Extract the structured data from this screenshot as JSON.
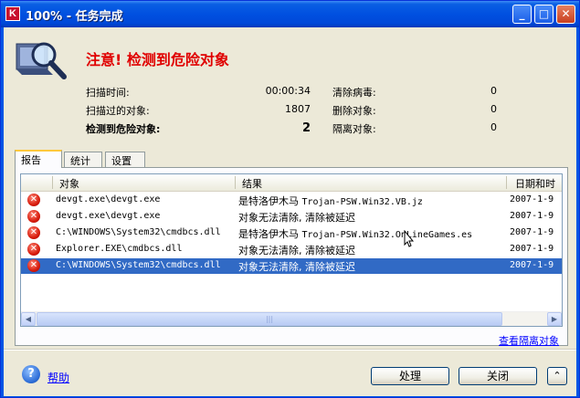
{
  "window": {
    "app_icon": "K",
    "title": "100% - 任务完成",
    "controls": {
      "minimize": "_",
      "maximize": "□",
      "close": "✕"
    }
  },
  "header": {
    "headline": "注意! 检测到危险对象",
    "icon": "magnifier-scan-icon"
  },
  "stats": {
    "rows": [
      {
        "label1": "扫描时间:",
        "value1": "00:00:34",
        "label2": "清除病毒:",
        "value2": "0"
      },
      {
        "label1": "扫描过的对象:",
        "value1": "1807",
        "label2": "删除对象:",
        "value2": "0"
      },
      {
        "label1": "检测到危险对象:",
        "value1": "2",
        "label2": "隔离对象:",
        "value2": "0"
      }
    ]
  },
  "tabs": [
    {
      "label": "报告",
      "active": true
    },
    {
      "label": "统计",
      "active": false
    },
    {
      "label": "设置",
      "active": false
    }
  ],
  "report": {
    "columns": {
      "object": "对象",
      "result": "结果",
      "datetime": "日期和时"
    },
    "rows": [
      {
        "icon": "error-icon",
        "object": "devgt.exe\\devgt.exe",
        "result_prefix": "是特洛伊木马 ",
        "result_mono": "Trojan-PSW.Win32.VB.jz",
        "date": "2007-1-9",
        "selected": false
      },
      {
        "icon": "error-icon",
        "object": "devgt.exe\\devgt.exe",
        "result_prefix": "对象无法清除, 清除被延迟",
        "result_mono": "",
        "date": "2007-1-9",
        "selected": false
      },
      {
        "icon": "error-icon",
        "object": "C:\\WINDOWS\\System32\\cmdbcs.dll",
        "result_prefix": "是特洛伊木马 ",
        "result_mono": "Trojan-PSW.Win32.OnLineGames.es",
        "date": "2007-1-9",
        "selected": false
      },
      {
        "icon": "error-icon",
        "object": "Explorer.EXE\\cmdbcs.dll",
        "result_prefix": "对象无法清除, 清除被延迟",
        "result_mono": "",
        "date": "2007-1-9",
        "selected": false
      },
      {
        "icon": "error-icon",
        "object": "C:\\WINDOWS\\System32\\cmdbcs.dll",
        "result_prefix": "对象无法清除, 清除被延迟",
        "result_mono": "",
        "date": "2007-1-9",
        "selected": true
      }
    ]
  },
  "links": {
    "view_quarantine": "查看隔离对象",
    "help": "帮助"
  },
  "buttons": {
    "process": "处理",
    "close": "关闭",
    "collapse": "⌃"
  },
  "colors": {
    "headline": "#e00000",
    "selection": "#316ac5",
    "titlebar": "#0050e0"
  }
}
